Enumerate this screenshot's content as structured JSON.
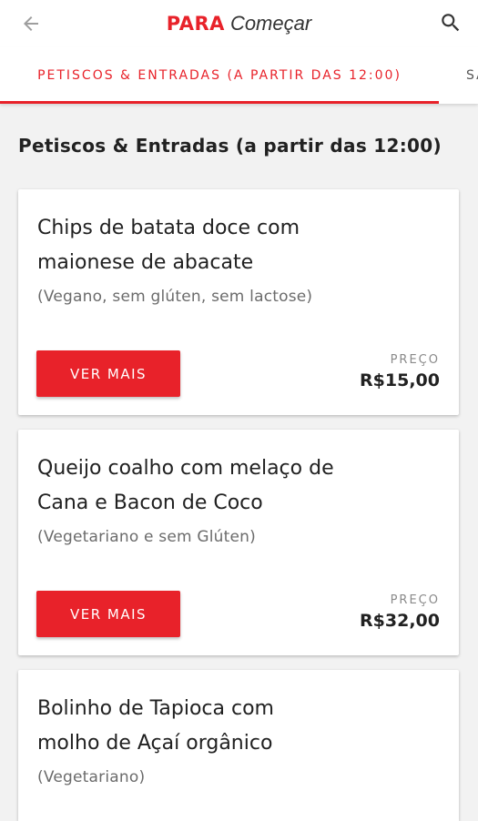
{
  "header": {
    "title_brand": "PARA",
    "title_sub": "Começar",
    "back_icon": "arrow-left-icon",
    "search_icon": "search-icon"
  },
  "tabs": [
    {
      "label": "PETISCOS & ENTRADAS (A PARTIR DAS 12:00)",
      "active": true
    },
    {
      "label": "SA",
      "active": false
    }
  ],
  "section": {
    "title": "Petiscos & Entradas (a partir das 12:00)"
  },
  "items": [
    {
      "name": "Chips de batata doce com maionese de abacate",
      "description": "(Vegano, sem glúten, sem lactose)",
      "button_label": "VER MAIS",
      "price_label": "PREÇO",
      "price": "R$15,00"
    },
    {
      "name": "Queijo coalho com melaço de Cana e Bacon de Coco",
      "description": "(Vegetariano e sem Glúten)",
      "button_label": "VER MAIS",
      "price_label": "PREÇO",
      "price": "R$32,00"
    },
    {
      "name": "Bolinho de Tapioca com molho de Açaí orgânico",
      "description": "(Vegetariano)"
    }
  ],
  "colors": {
    "accent": "#e8222a",
    "background": "#f2f2f2",
    "card": "#ffffff"
  }
}
